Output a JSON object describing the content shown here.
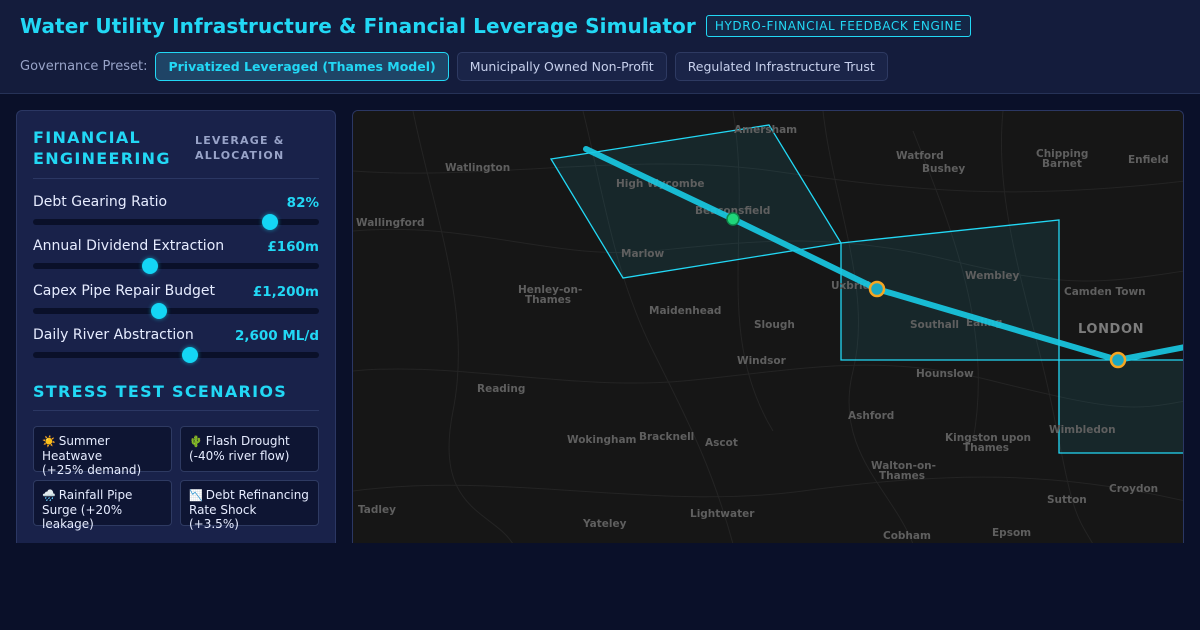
{
  "header": {
    "title": "Water Utility Infrastructure & Financial Leverage Simulator",
    "badge": "HYDRO-FINANCIAL FEEDBACK ENGINE",
    "preset_label": "Governance Preset:",
    "presets": [
      {
        "label": "Privatized Leveraged (Thames Model)",
        "active": true
      },
      {
        "label": "Municipally Owned Non-Profit",
        "active": false
      },
      {
        "label": "Regulated Infrastructure Trust",
        "active": false
      }
    ]
  },
  "panel": {
    "financial_title_line1": "FINANCIAL",
    "financial_title_line2": "ENGINEERING",
    "financial_subtitle_line1": "LEVERAGE &",
    "financial_subtitle_line2": "ALLOCATION",
    "sliders": [
      {
        "label": "Debt Gearing Ratio",
        "value": "82%",
        "fraction": 0.83
      },
      {
        "label": "Annual Dividend Extraction",
        "value": "£160m",
        "fraction": 0.41
      },
      {
        "label": "Capex Pipe Repair Budget",
        "value": "£1,200m",
        "fraction": 0.44
      },
      {
        "label": "Daily River Abstraction",
        "value": "2,600 ML/d",
        "fraction": 0.55
      }
    ],
    "stress_title": "STRESS TEST SCENARIOS",
    "scenarios": [
      {
        "icon": "☀️",
        "line1": "Summer Heatwave",
        "line2": "(+25% demand)"
      },
      {
        "icon": "🌵",
        "line1": "Flash Drought",
        "line2": "(-40% river flow)"
      },
      {
        "icon": "🌧️",
        "line1": "Rainfall Pipe",
        "line2": "Surge (+20% leakage)"
      },
      {
        "icon": "📉",
        "line1": "Debt Refinancing",
        "line2": "Rate Shock (+3.5%)"
      }
    ]
  },
  "map": {
    "colors": {
      "accent": "#22d8f5",
      "river": "#19c8e2",
      "node_green": "#1fd67a",
      "node_amber": "#f5a623"
    },
    "towns": {
      "amersham": "Amersham",
      "watford": "Watford",
      "bushey": "Bushey",
      "chipping_barnet_1": "Chipping",
      "chipping_barnet_2": "Barnet",
      "enfield": "Enfield",
      "watlington": "Watlington",
      "high_wycombe": "High Wycombe",
      "beaconsfield": "Beaconsfield",
      "wallingford": "Wallingford",
      "marlow": "Marlow",
      "wembley": "Wembley",
      "henley_1": "Henley-on-",
      "henley_2": "Thames",
      "uxbridge": "Uxbridge",
      "camden_town": "Camden Town",
      "maidenhead": "Maidenhead",
      "slough": "Slough",
      "southall": "Southall",
      "ealing": "Ealing",
      "london": "LONDON",
      "windsor": "Windsor",
      "hounslow": "Hounslow",
      "reading": "Reading",
      "ashford": "Ashford",
      "wokingham": "Wokingham",
      "bracknell": "Bracknell",
      "ascot": "Ascot",
      "kingston_1": "Kingston upon",
      "kingston_2": "Thames",
      "wimbledon": "Wimbledon",
      "walton_1": "Walton-on-",
      "walton_2": "Thames",
      "croydon": "Croydon",
      "tadley": "Tadley",
      "sutton": "Sutton",
      "yateley": "Yateley",
      "lightwater": "Lightwater",
      "cobham": "Cobham",
      "epsom": "Epsom"
    }
  }
}
